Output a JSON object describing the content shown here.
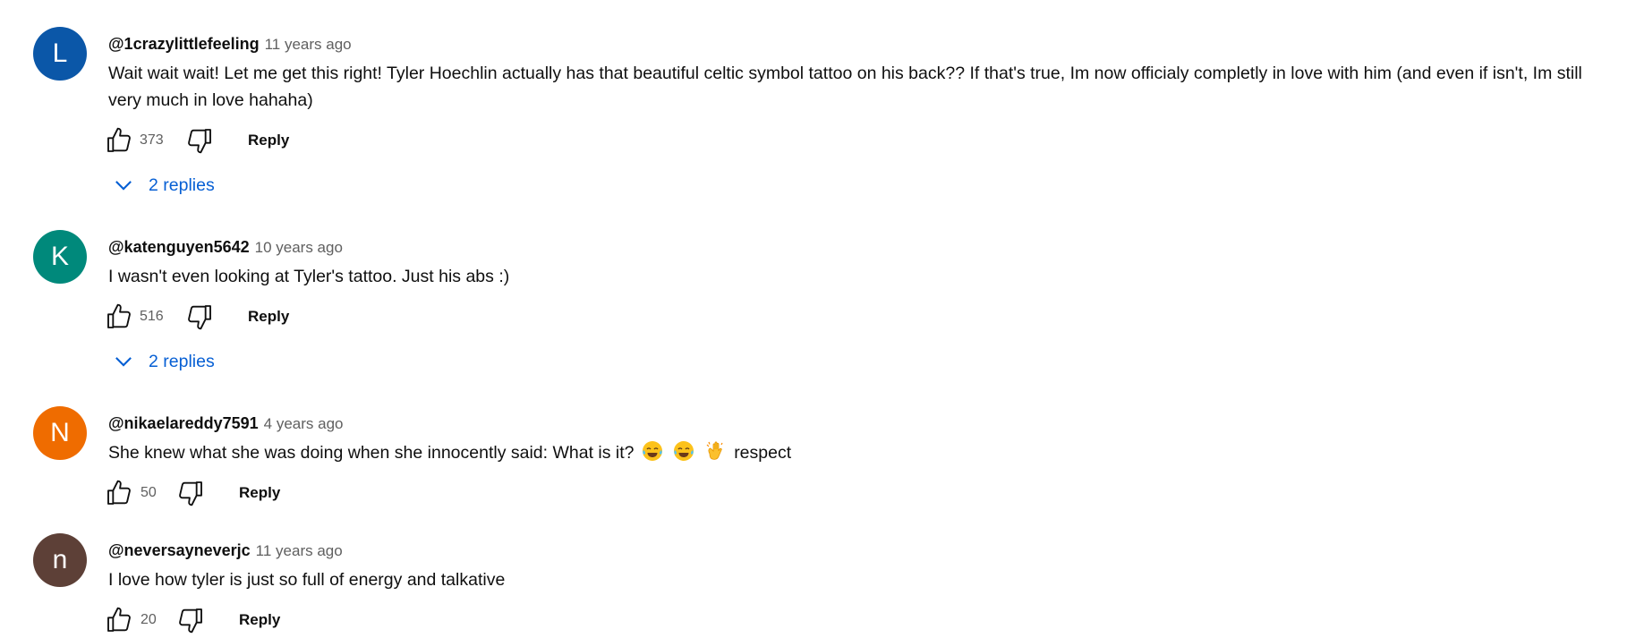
{
  "comments": [
    {
      "avatar_letter": "L",
      "avatar_color": "#0b57a8",
      "author": "@1crazylittlefeeling",
      "time": "11 years ago",
      "text": "Wait wait wait! Let me get this right! Tyler Hoechlin actually has that beautiful celtic symbol tattoo on his back?? If that's true, Im now officialy completly in love with him (and even if isn't, Im still very much in love hahaha)",
      "likes": "373",
      "reply_label": "Reply",
      "replies_label": "2 replies"
    },
    {
      "avatar_letter": "K",
      "avatar_color": "#00897b",
      "author": "@katenguyen5642",
      "time": "10 years ago",
      "text": "I wasn't even looking at Tyler's tattoo. Just his abs :)",
      "likes": "516",
      "reply_label": "Reply",
      "replies_label": "2 replies"
    },
    {
      "avatar_letter": "N",
      "avatar_color": "#ef6c00",
      "author": "@nikaelareddy7591",
      "time": "4 years ago",
      "text_before_emoji": "She knew what she was doing when she innocently said: What is it?",
      "emojis": [
        "tears-of-joy-emoji",
        "tears-of-joy-emoji",
        "clapping-hands-emoji"
      ],
      "text_after_emoji": "respect",
      "likes": "50",
      "reply_label": "Reply"
    },
    {
      "avatar_letter": "n",
      "avatar_color": "#5d4037",
      "author": "@neversayneverjc",
      "time": "11 years ago",
      "text": "I love how tyler is just so full of energy and talkative",
      "likes": "20",
      "reply_label": "Reply"
    }
  ]
}
